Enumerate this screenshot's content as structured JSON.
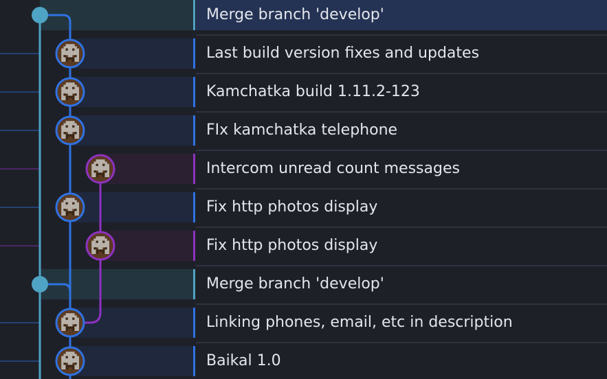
{
  "graph": {
    "colors": {
      "background": "#1e2028",
      "separator": "#2f323c",
      "merge_lane": "#4fa3c4",
      "main_lane": "#2f72e2",
      "feature_lane": "#8e32c0",
      "merge_row_bg": "#23363f",
      "main_row_bg": "#1f283c",
      "feature_row_bg": "#2a2032",
      "selected_row_bg": "#243354"
    },
    "avatar_icon": "pixel-avatar-icon",
    "merge_dot_icon": "merge-dot-icon"
  },
  "commits": [
    {
      "message": "Merge branch 'develop'",
      "lane": "merge",
      "selected": true
    },
    {
      "message": "Last build version fixes and updates",
      "lane": "main"
    },
    {
      "message": "Kamchatka build 1.11.2-123",
      "lane": "main"
    },
    {
      "message": "FIx kamchatka telephone",
      "lane": "main"
    },
    {
      "message": "Intercom unread count messages",
      "lane": "feature"
    },
    {
      "message": "Fix http photos display",
      "lane": "main"
    },
    {
      "message": "Fix http photos display",
      "lane": "feature"
    },
    {
      "message": "Merge branch 'develop'",
      "lane": "merge"
    },
    {
      "message": "Linking phones, email, etc in description",
      "lane": "main"
    },
    {
      "message": "Baikal 1.0",
      "lane": "main"
    }
  ]
}
